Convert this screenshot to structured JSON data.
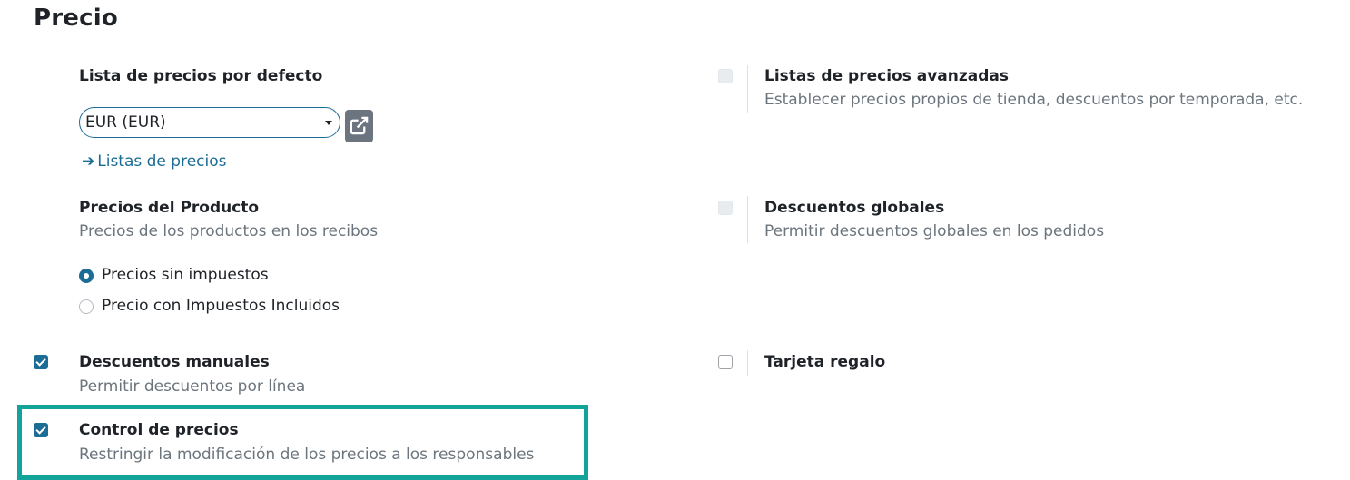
{
  "section": {
    "title": "Precio"
  },
  "default_pricelist": {
    "title": "Lista de precios por defecto",
    "selected": "EUR (EUR)",
    "link_label": "Listas de precios",
    "link_arrow": "➔"
  },
  "advanced_pricelists": {
    "title": "Listas de precios avanzadas",
    "description": "Establecer precios propios de tienda, descuentos por temporada, etc.",
    "checked": false
  },
  "product_prices": {
    "title": "Precios del Producto",
    "description": "Precios de los productos en los recibos",
    "options": [
      {
        "label": "Precios sin impuestos",
        "selected": true
      },
      {
        "label": "Precio con Impuestos Incluidos",
        "selected": false
      }
    ]
  },
  "global_discounts": {
    "title": "Descuentos globales",
    "description": "Permitir descuentos globales en los pedidos",
    "checked": false
  },
  "manual_discounts": {
    "title": "Descuentos manuales",
    "description": "Permitir descuentos por línea",
    "checked": true
  },
  "gift_card": {
    "title": "Tarjeta regalo",
    "checked": false
  },
  "price_control": {
    "title": "Control de precios",
    "description": "Restringir la modificación de los precios a los responsables",
    "checked": true
  },
  "colors": {
    "accent": "#1c6d95",
    "highlight_border": "#12a39a",
    "muted_text": "#6c757d"
  }
}
